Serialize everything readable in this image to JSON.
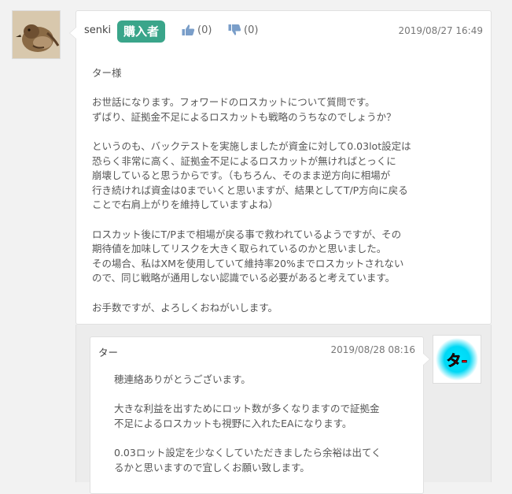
{
  "post": {
    "author": "senki",
    "badge": "購入者",
    "likes": "(0)",
    "dislikes": "(0)",
    "date": "2019/08/27 16:49",
    "paragraphs": [
      "ター様",
      "お世話になります。フォワードのロスカットについて質問です。\nずばり、証拠金不足によるロスカットも戦略のうちなのでしょうか？",
      "というのも、バックテストを実施しましたが資金に対して0.03lot設定は\n恐らく非常に高く、証拠金不足によるロスカットが無ければとっくに\n崩壊していると思うからです。（もちろん、そのまま逆方向に相場が\n行き続ければ資金は0までいくと思いますが、結果としてT/P方向に戻る\nことで右肩上がりを維持していますよね）",
      "ロスカット後にT/Pまで相場が戻る事で救われているようですが、その\n期待値を加味してリスクを大きく取られているのかと思いました。\nその場合、私はXMを使用していて維持率20%までロスカットされない\nので、同じ戦略が通用しない認識でいる必要があると考えています。",
      "お手数ですが、よろしくおねがいします。"
    ]
  },
  "reply": {
    "author": "ター",
    "date": "2019/08/28 08:16",
    "avatar_text": "タ-",
    "paragraphs": [
      "穂連絡ありがとうございます。",
      "大きな利益を出すためにロット数が多くなりますので証拠金\n不足によるロスカットも視野に入れたEAになります。",
      "0.03ロット設定を少なくしていただきましたら余裕は出てく\nるかと思いますので宜しくお願い致します。"
    ]
  },
  "colors": {
    "badge": "#3aa58a",
    "thumb": "#7a9ec9",
    "reply_avatar_glow": "#00e5ff",
    "reply_avatar_text": "#e00000"
  },
  "icons": {
    "like": "thumbs-up-icon",
    "dislike": "thumbs-down-icon"
  }
}
